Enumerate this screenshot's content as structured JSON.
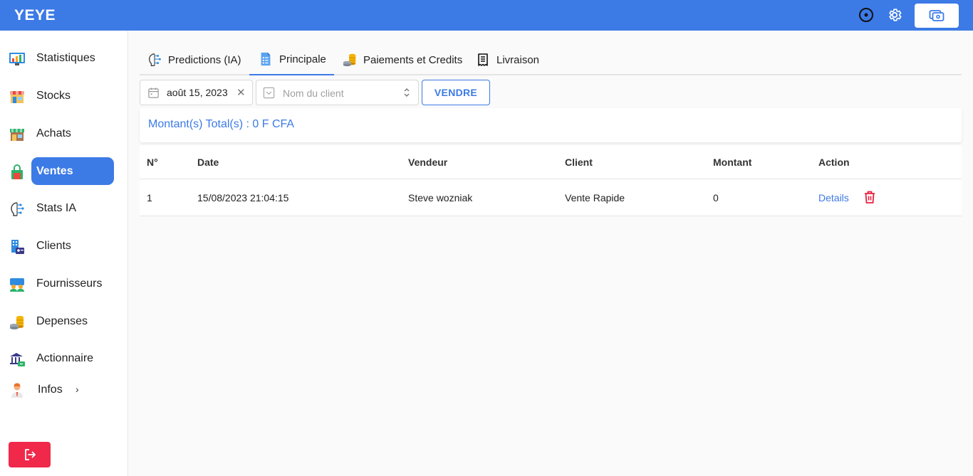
{
  "app": {
    "title": "YEYE"
  },
  "colors": {
    "primary": "#3c7ae6",
    "danger": "#f0294a"
  },
  "topbar": {
    "icons": [
      "target-icon",
      "gear-icon",
      "screen-icon"
    ]
  },
  "sidebar": {
    "items": [
      {
        "label": "Statistiques",
        "icon": "stats-chart-icon"
      },
      {
        "label": "Stocks",
        "icon": "store-icon"
      },
      {
        "label": "Achats",
        "icon": "shop-icon"
      },
      {
        "label": "Ventes",
        "icon": "shopping-bag-icon",
        "active": true
      },
      {
        "label": "Stats IA",
        "icon": "brain-icon"
      },
      {
        "label": "Clients",
        "icon": "clients-icon"
      },
      {
        "label": "Fournisseurs",
        "icon": "suppliers-icon"
      },
      {
        "label": "Depenses",
        "icon": "coins-icon"
      },
      {
        "label": "Actionnaire",
        "icon": "bank-icon"
      },
      {
        "label": "Infos",
        "icon": "person-icon"
      }
    ],
    "logout_icon": "logout-icon"
  },
  "tabs": [
    {
      "label": "Predictions (IA)",
      "icon": "brain-icon"
    },
    {
      "label": "Principale",
      "icon": "document-list-icon",
      "active": true
    },
    {
      "label": "Paiements et Credits",
      "icon": "coins-icon"
    },
    {
      "label": "Livraison",
      "icon": "receipt-icon"
    }
  ],
  "filters": {
    "date_value": "août 15, 2023",
    "client_placeholder": "Nom du client",
    "vendre_label": "VENDRE"
  },
  "summary": {
    "total_text": "Montant(s) Total(s) : 0 F CFA"
  },
  "table": {
    "headers": [
      "N°",
      "Date",
      "Vendeur",
      "Client",
      "Montant",
      "Action"
    ],
    "rows": [
      {
        "num": "1",
        "date": "15/08/2023 21:04:15",
        "vendeur": "Steve wozniak",
        "client": "Vente Rapide",
        "montant": "0",
        "action": "Details"
      }
    ]
  }
}
